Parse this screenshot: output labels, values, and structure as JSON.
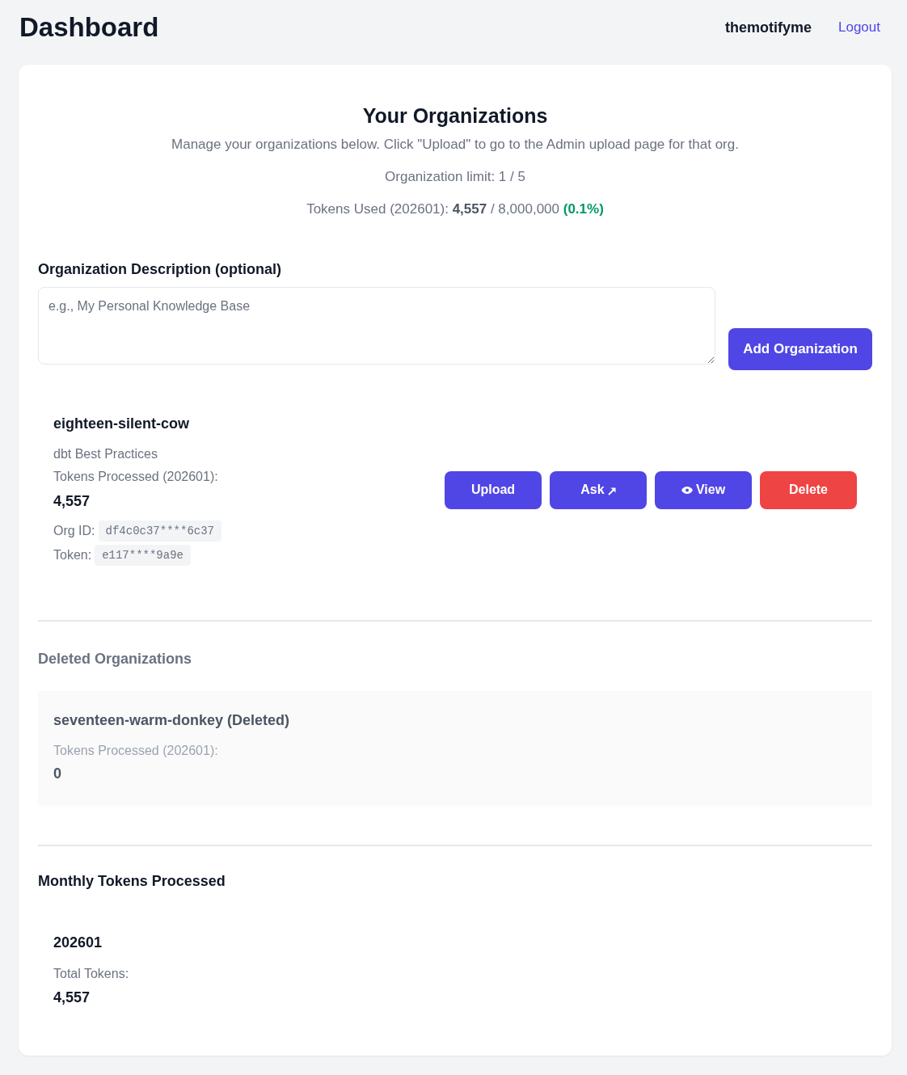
{
  "header": {
    "title": "Dashboard",
    "username": "themotifyme",
    "logout": "Logout"
  },
  "intro": {
    "title": "Your Organizations",
    "description": "Manage your organizations below. Click \"Upload\" to go to the Admin upload page for that org.",
    "limit": "Organization limit: 1 / 5",
    "usage": {
      "text": "Tokens Used (202601): **4,557** / 8,000,000",
      "percent": "(0.1%)"
    }
  },
  "new_org": {
    "label": "Organization Description (optional)",
    "placeholder": "e.g., My Personal Knowledge Base",
    "button": "Add Organization"
  },
  "organizations": [
    {
      "name": "eighteen-silent-cow",
      "description": "dbt Best Practices",
      "tokens_label": "Tokens Processed (202601):",
      "tokens": "4,557",
      "org_id_label": "Org ID:",
      "org_id": "df4c0c37****6c37",
      "token_label": "Token:",
      "token": "e117****9a9e",
      "actions": [
        {
          "label": "Upload",
          "kind": "primary"
        },
        {
          "label": "Ask",
          "kind": "external"
        },
        {
          "label": "View",
          "kind": "view"
        },
        {
          "label": "Delete",
          "kind": "danger"
        }
      ]
    }
  ],
  "deleted": {
    "title": "Deleted Organizations",
    "items": [
      {
        "name": "seventeen-warm-donkey (Deleted)",
        "tokens_label": "Tokens Processed (202601):",
        "tokens": "0"
      }
    ]
  },
  "monthly": {
    "title": "Monthly Tokens Processed",
    "months": [
      {
        "month": "202601",
        "total_label": "Total Tokens:",
        "total": "4,557"
      }
    ]
  }
}
